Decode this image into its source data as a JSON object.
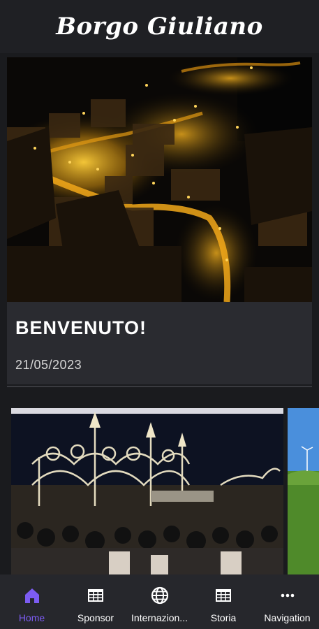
{
  "header": {
    "title": "Borgo Giuliano"
  },
  "article": {
    "title": "BENVENUTO!",
    "date": "21/05/2023"
  },
  "colors": {
    "background": "#1f2024",
    "card": "#2a2b30",
    "nav_background": "#26272c",
    "accent": "#7c5cf2",
    "night_light": "#f0a818"
  },
  "nav": {
    "items": [
      {
        "label": "Home",
        "icon": "home-icon",
        "active": true
      },
      {
        "label": "Sponsor",
        "icon": "table-icon",
        "active": false
      },
      {
        "label": "Internazion...",
        "icon": "globe-icon",
        "active": false
      },
      {
        "label": "Storia",
        "icon": "table-icon",
        "active": false
      },
      {
        "label": "Navigation",
        "icon": "more-icon",
        "active": false
      }
    ]
  }
}
